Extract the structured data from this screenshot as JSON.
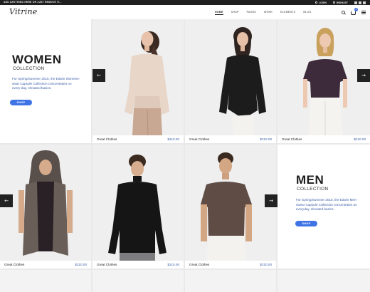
{
  "topbar": {
    "announcement": "ADD ANYTHING HERE OR JUST REMOVE IT...",
    "login": "LOGIN",
    "wishlist": "WISHLIST"
  },
  "header": {
    "logo": "Vitrine",
    "nav": [
      "HOME",
      "SHOP",
      "PAGES",
      "WORK",
      "ELEMENTS",
      "BLOG"
    ],
    "cart_count": "0"
  },
  "promos": {
    "women": {
      "title": "WOMEN",
      "subtitle": "COLLECTION",
      "description": "For Spring/Summer 2015, the Edwin Womens-wear Capsule Collection concentrates on every-day, elevated basics.",
      "button": "SHOP"
    },
    "men": {
      "title": "MEN",
      "subtitle": "COLLECTION",
      "description": "For Spring/Summer 2015, the Edwin Men-swear Capsule Collection concentrates on everyday, elevated basics.",
      "button": "SHOP"
    }
  },
  "products_row1": [
    {
      "name": "Great Clothes",
      "price": "$210.00"
    },
    {
      "name": "Great Clothes",
      "price": "$210.00"
    },
    {
      "name": "Great Clothes",
      "price": "$210.00"
    }
  ],
  "products_row2": [
    {
      "name": "Great Clothes",
      "price": "$210.00"
    },
    {
      "name": "Great Clothes",
      "price": "$210.00"
    },
    {
      "name": "Great Clothes",
      "price": "$210.00"
    }
  ],
  "arrows": {
    "prev": "←",
    "next": "→"
  },
  "colors": {
    "accent": "#3f74e6",
    "price": "#3a5ea8",
    "dark": "#1f1f1f"
  }
}
